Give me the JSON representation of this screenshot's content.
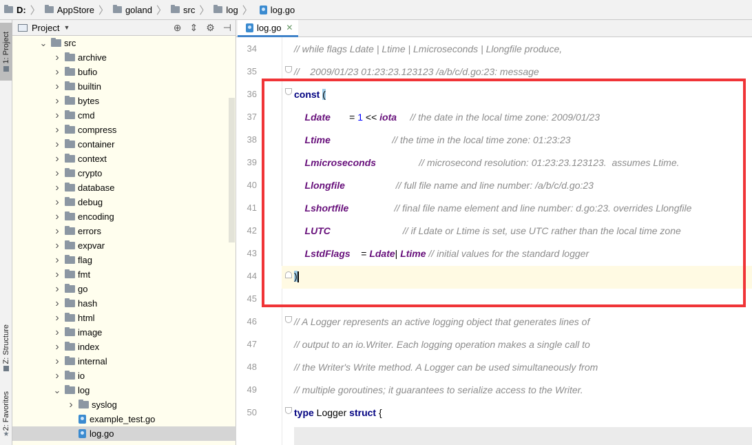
{
  "breadcrumb": [
    "D:",
    "AppStore",
    "goland",
    "src",
    "log",
    "log.go"
  ],
  "left_strip": {
    "project_tab": "1: Project",
    "structure_tab": "Z: Structure",
    "favorites_tab": "2: Favorites"
  },
  "project_panel": {
    "title": "Project"
  },
  "tree": [
    {
      "label": "src",
      "level": 0,
      "expanded": true
    },
    {
      "label": "archive",
      "level": 1
    },
    {
      "label": "bufio",
      "level": 1
    },
    {
      "label": "builtin",
      "level": 1
    },
    {
      "label": "bytes",
      "level": 1
    },
    {
      "label": "cmd",
      "level": 1
    },
    {
      "label": "compress",
      "level": 1
    },
    {
      "label": "container",
      "level": 1
    },
    {
      "label": "context",
      "level": 1
    },
    {
      "label": "crypto",
      "level": 1
    },
    {
      "label": "database",
      "level": 1
    },
    {
      "label": "debug",
      "level": 1
    },
    {
      "label": "encoding",
      "level": 1
    },
    {
      "label": "errors",
      "level": 1
    },
    {
      "label": "expvar",
      "level": 1
    },
    {
      "label": "flag",
      "level": 1
    },
    {
      "label": "fmt",
      "level": 1
    },
    {
      "label": "go",
      "level": 1
    },
    {
      "label": "hash",
      "level": 1
    },
    {
      "label": "html",
      "level": 1
    },
    {
      "label": "image",
      "level": 1
    },
    {
      "label": "index",
      "level": 1
    },
    {
      "label": "internal",
      "level": 1
    },
    {
      "label": "io",
      "level": 1
    },
    {
      "label": "log",
      "level": 1,
      "expanded": true
    },
    {
      "label": "syslog",
      "level": 2
    },
    {
      "label": "example_test.go",
      "level": 2,
      "file": true
    },
    {
      "label": "log.go",
      "level": 2,
      "file": true,
      "selected": true
    }
  ],
  "editor": {
    "tab": "log.go",
    "lines": [
      {
        "n": "34",
        "parts": [
          {
            "t": "// while flags Ldate | Ltime | Lmicroseconds | Llongfile produce,",
            "c": "cmt"
          }
        ]
      },
      {
        "n": "35",
        "parts": [
          {
            "t": "//    2009/01/23 01:23:23.123123 /a/b/c/d.go:23: message",
            "c": "cmt"
          }
        ]
      },
      {
        "n": "36",
        "parts": [
          {
            "t": "const",
            "c": "kw"
          },
          {
            "t": " ",
            "c": "op"
          },
          {
            "t": "(",
            "c": "hl-paren"
          }
        ]
      },
      {
        "n": "37",
        "parts": [
          {
            "t": "    Ldate",
            "c": "cst"
          },
          {
            "t": "       = ",
            "c": "op"
          },
          {
            "t": "1",
            "c": "num"
          },
          {
            "t": " << ",
            "c": "op"
          },
          {
            "t": "iota",
            "c": "cst"
          },
          {
            "t": "     // the date in the local time zone: 2009/01/23",
            "c": "cmt"
          }
        ]
      },
      {
        "n": "38",
        "parts": [
          {
            "t": "    Ltime",
            "c": "cst"
          },
          {
            "t": "                       // the time in the local time zone: 01:23:23",
            "c": "cmt"
          }
        ]
      },
      {
        "n": "39",
        "parts": [
          {
            "t": "    Lmicroseconds",
            "c": "cst"
          },
          {
            "t": "                // microsecond resolution: 01:23:23.123123.  assumes Ltime.",
            "c": "cmt"
          }
        ]
      },
      {
        "n": "40",
        "parts": [
          {
            "t": "    Llongfile",
            "c": "cst"
          },
          {
            "t": "                   // full file name and line number: /a/b/c/d.go:23",
            "c": "cmt"
          }
        ]
      },
      {
        "n": "41",
        "parts": [
          {
            "t": "    Lshortfile",
            "c": "cst"
          },
          {
            "t": "                 // final file name element and line number: d.go:23. overrides Llongfile",
            "c": "cmt"
          }
        ]
      },
      {
        "n": "42",
        "parts": [
          {
            "t": "    LUTC",
            "c": "cst"
          },
          {
            "t": "                           // if Ldate or Ltime is set, use UTC rather than the local time zone",
            "c": "cmt"
          }
        ]
      },
      {
        "n": "43",
        "parts": [
          {
            "t": "    LstdFlags",
            "c": "cst"
          },
          {
            "t": "    = ",
            "c": "op"
          },
          {
            "t": "Ldate",
            "c": "cst"
          },
          {
            "t": "| ",
            "c": "op"
          },
          {
            "t": "Ltime",
            "c": "cst"
          },
          {
            "t": " // initial values for the standard logger",
            "c": "cmt"
          }
        ]
      },
      {
        "n": "44",
        "parts": [
          {
            "t": ")",
            "c": "hl-paren"
          }
        ]
      },
      {
        "n": "45",
        "parts": []
      },
      {
        "n": "46",
        "parts": [
          {
            "t": "// A Logger represents an active logging object that generates lines of",
            "c": "cmt"
          }
        ]
      },
      {
        "n": "47",
        "parts": [
          {
            "t": "// output to an io.Writer. Each logging operation makes a single call to",
            "c": "cmt"
          }
        ]
      },
      {
        "n": "48",
        "parts": [
          {
            "t": "// the Writer's Write method. A Logger can be used simultaneously from",
            "c": "cmt"
          }
        ]
      },
      {
        "n": "49",
        "parts": [
          {
            "t": "// multiple goroutines; it guarantees to serialize access to the Writer.",
            "c": "cmt"
          }
        ]
      },
      {
        "n": "50",
        "parts": [
          {
            "t": "type",
            "c": "kw"
          },
          {
            "t": " Logger ",
            "c": "op"
          },
          {
            "t": "struct",
            "c": "kw"
          },
          {
            "t": " {",
            "c": "op"
          }
        ]
      }
    ]
  },
  "colors": {
    "highlight_box": "#f03437",
    "tree_bg": "#fffeee",
    "current_line": "#fffae3"
  }
}
